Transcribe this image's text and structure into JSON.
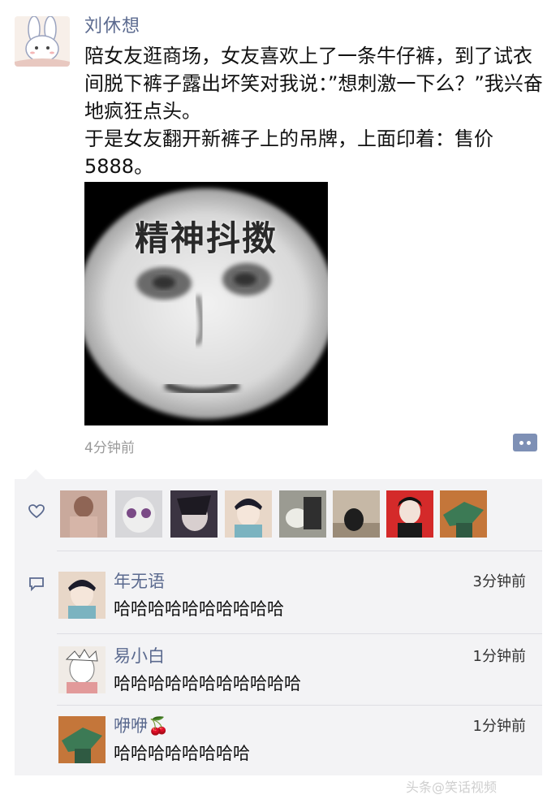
{
  "post": {
    "author": "刘休想",
    "text": "陪女友逛商场，女友喜欢上了一条牛仔裤，到了试衣间脱下裤子露出坏笑对我说：”想刺激一下么？”我兴奋地疯狂点头。\n于是女友翻开新裤子上的吊牌，上面印着：售价5888。",
    "image_caption": "精神抖擞",
    "time": "4分钟前"
  },
  "likes": {
    "avatars": [
      "avatar-1",
      "avatar-2",
      "avatar-3",
      "avatar-4",
      "avatar-5",
      "avatar-6",
      "avatar-7",
      "avatar-8"
    ]
  },
  "comments": [
    {
      "name": "年无语",
      "time": "3分钟前",
      "text": "哈哈哈哈哈哈哈哈哈哈"
    },
    {
      "name": "易小白",
      "time": "1分钟前",
      "text": "哈哈哈哈哈哈哈哈哈哈哈"
    },
    {
      "name": "咿咿",
      "emoji": "🍒",
      "time": "1分钟前",
      "text": "哈哈哈哈哈哈哈哈"
    }
  ],
  "watermark": "头条@笑话视频",
  "colors": {
    "name_link": "#5b6a8f",
    "panel_bg": "#f3f3f5",
    "more_button": "#7e90b5"
  }
}
